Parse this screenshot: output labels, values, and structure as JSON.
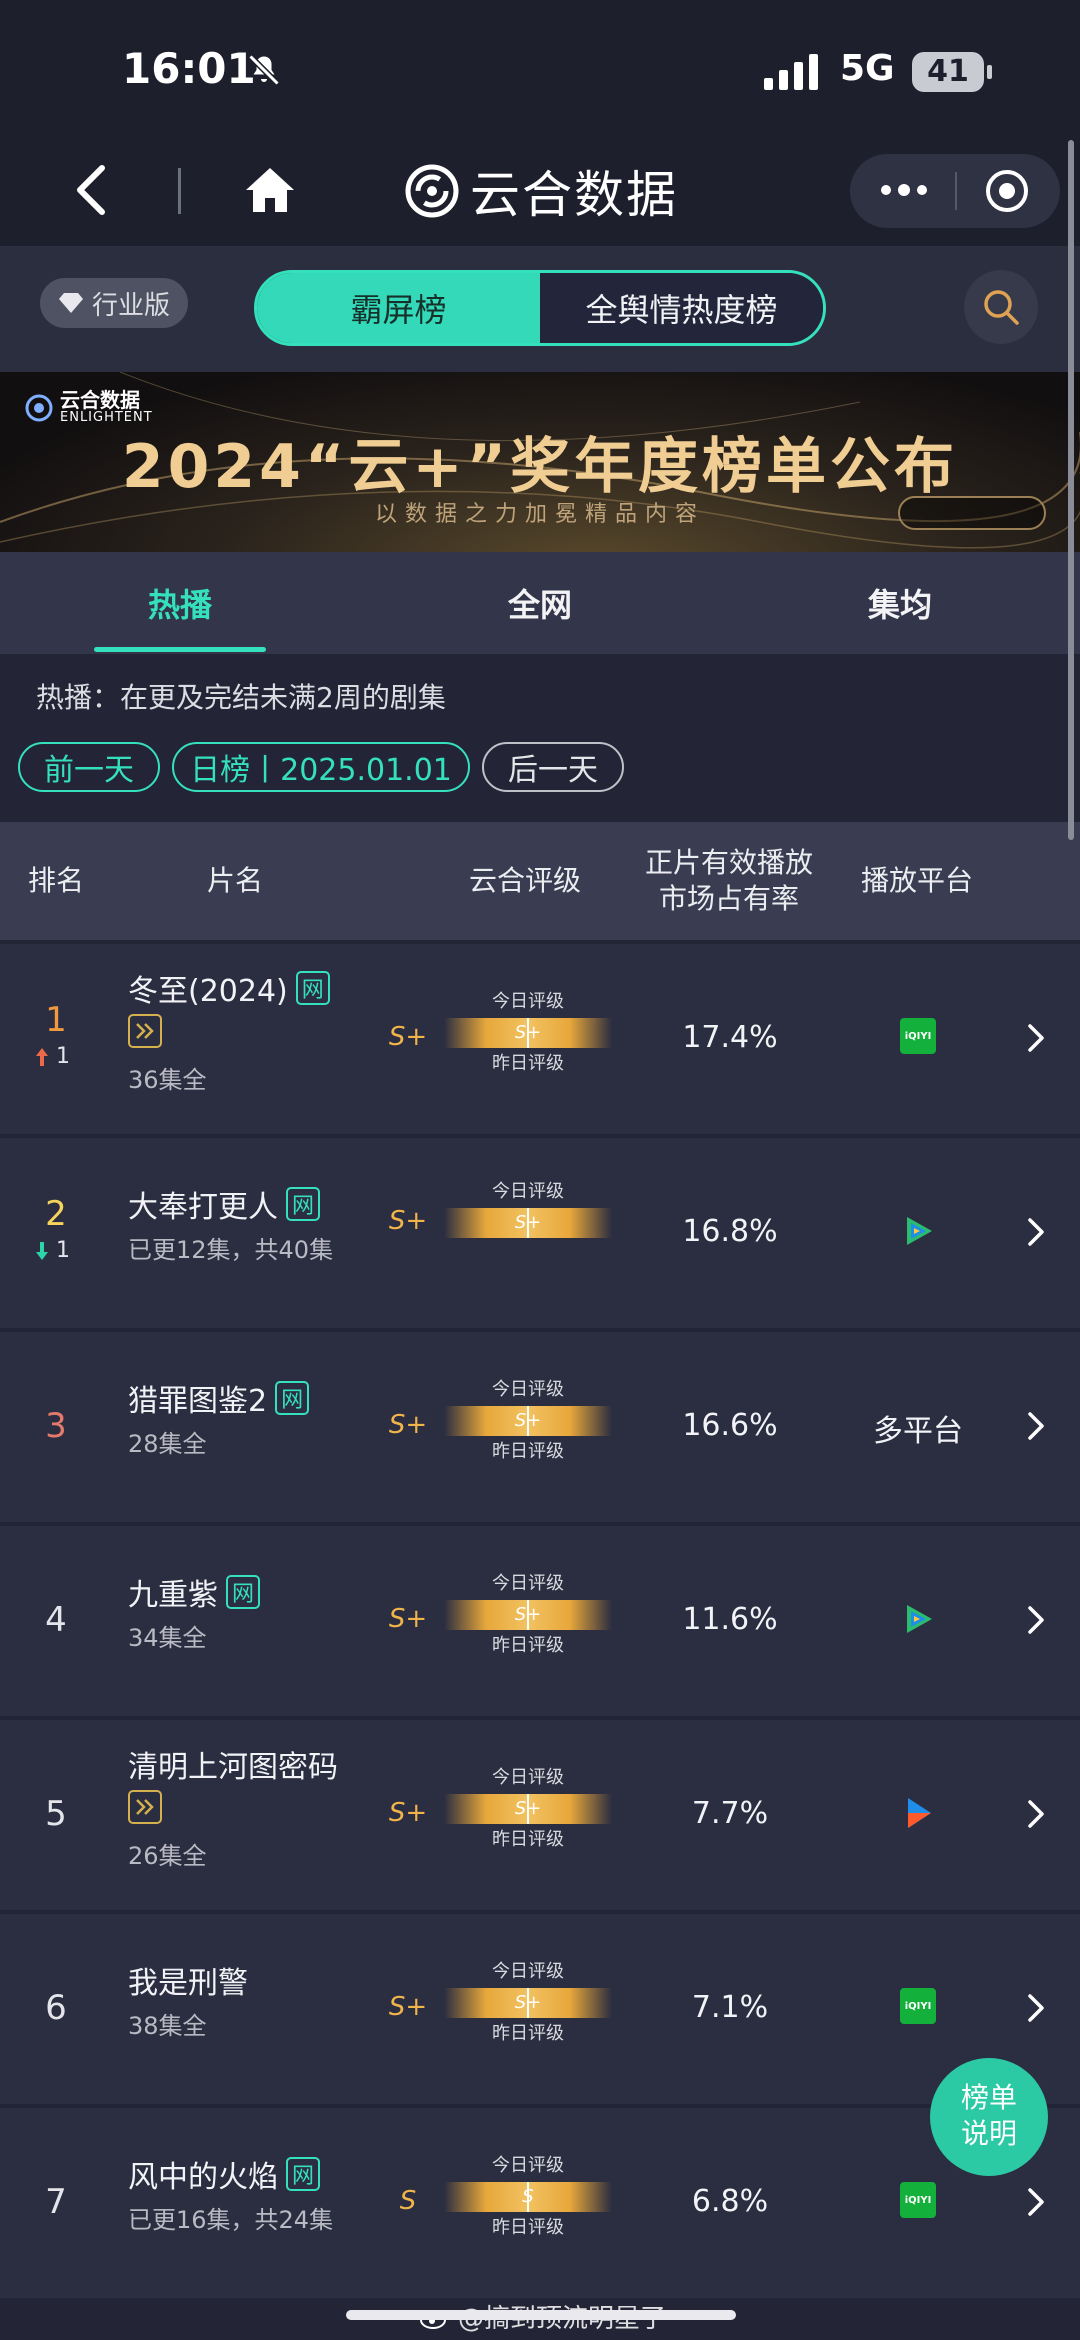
{
  "status_bar": {
    "time": "16:01",
    "network": "5G",
    "battery": "41"
  },
  "app": {
    "title": "云合数据"
  },
  "toolbar": {
    "edition_label": "行业版",
    "segments": [
      {
        "label": "霸屏榜",
        "active": true
      },
      {
        "label": "全舆情热度榜",
        "active": false
      }
    ]
  },
  "banner": {
    "logo_text": "云合数据",
    "logo_sub": "ENLIGHTENT",
    "title": "2024“云+”奖年度榜单公布",
    "subtitle": "以数据之力加冕精品内容"
  },
  "subtabs": [
    {
      "label": "热播",
      "active": true
    },
    {
      "label": "全网",
      "active": false
    },
    {
      "label": "集均",
      "active": false
    }
  ],
  "description": "热播：在更及完结未满2周的剧集",
  "date_nav": {
    "prev_label": "前一天",
    "date_label": "日榜丨2025.01.01",
    "next_label": "后一天"
  },
  "table": {
    "headers": {
      "rank": "排名",
      "name": "片名",
      "rating": "云合评级",
      "share_line1": "正片有效播放",
      "share_line2": "市场占有率",
      "platform": "播放平台"
    },
    "rating_today_label": "今日评级",
    "rating_yesterday_label": "昨日评级",
    "rows": [
      {
        "rank": "1",
        "change": "1",
        "change_dir": "up",
        "title": "冬至(2024)",
        "web_badge": "网",
        "pp_badge": true,
        "episodes": "36集全",
        "grade": "S+",
        "today": "S+",
        "has_yesterday": true,
        "share": "17.4%",
        "platform": "iqiyi",
        "platform_text": ""
      },
      {
        "rank": "2",
        "change": "1",
        "change_dir": "down",
        "title": "大奉打更人",
        "web_badge": "网",
        "pp_badge": false,
        "episodes": "已更12集，共40集",
        "grade": "S+",
        "today": "S+",
        "has_yesterday": false,
        "share": "16.8%",
        "platform": "tencent",
        "platform_text": ""
      },
      {
        "rank": "3",
        "change": "",
        "change_dir": "",
        "title": "猎罪图鉴2",
        "web_badge": "网",
        "pp_badge": false,
        "episodes": "28集全",
        "grade": "S+",
        "today": "S+",
        "has_yesterday": true,
        "share": "16.6%",
        "platform": "text",
        "platform_text": "多平台"
      },
      {
        "rank": "4",
        "change": "",
        "change_dir": "",
        "title": "九重紫",
        "web_badge": "网",
        "pp_badge": false,
        "episodes": "34集全",
        "grade": "S+",
        "today": "S+",
        "has_yesterday": true,
        "share": "11.6%",
        "platform": "tencent",
        "platform_text": ""
      },
      {
        "rank": "5",
        "change": "",
        "change_dir": "",
        "title": "清明上河图密码",
        "web_badge": "",
        "pp_badge": true,
        "episodes": "26集全",
        "grade": "S+",
        "today": "S+",
        "has_yesterday": true,
        "share": "7.7%",
        "platform": "youku",
        "platform_text": ""
      },
      {
        "rank": "6",
        "change": "",
        "change_dir": "",
        "title": "我是刑警",
        "web_badge": "",
        "pp_badge": false,
        "episodes": "38集全",
        "grade": "S+",
        "today": "S+",
        "has_yesterday": true,
        "share": "7.1%",
        "platform": "iqiyi",
        "platform_text": ""
      },
      {
        "rank": "7",
        "change": "",
        "change_dir": "",
        "title": "风中的火焰",
        "web_badge": "网",
        "pp_badge": false,
        "episodes": "已更16集，共24集",
        "grade": "S",
        "today": "S",
        "has_yesterday": true,
        "share": "6.8%",
        "platform": "iqiyi",
        "platform_text": ""
      }
    ]
  },
  "iqiyi_label": "iQIYI",
  "fab": {
    "line1": "榜单",
    "line2": "说明"
  },
  "watermark": "@搞到顶流明星了",
  "colors": {
    "accent": "#35e0bd",
    "gold": "#f0b44a",
    "bg": "#232536",
    "row_bg": "#2b2d40"
  }
}
